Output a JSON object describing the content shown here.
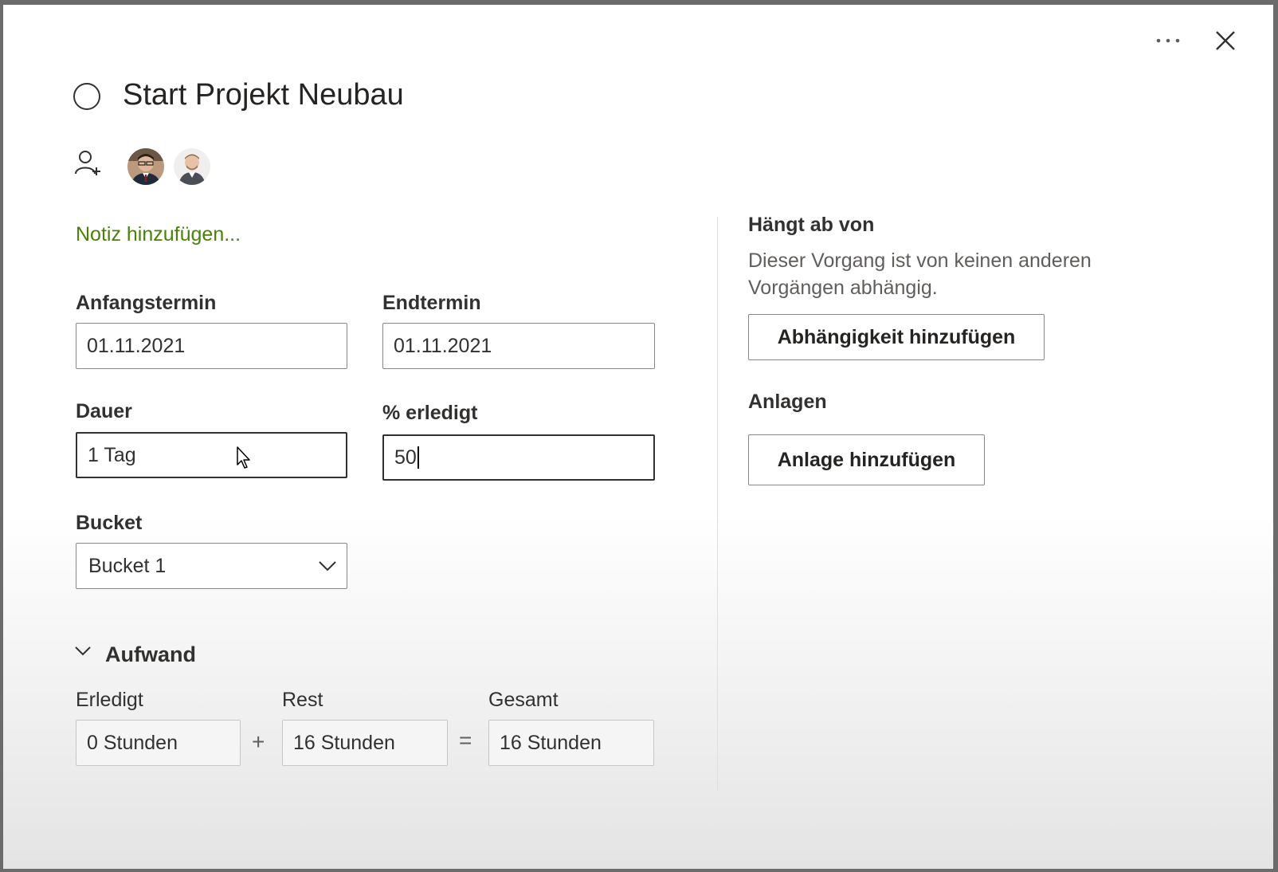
{
  "task": {
    "title": "Start Projekt Neubau",
    "add_note": "Notiz hinzufügen..."
  },
  "header": {
    "more_icon": "more-horizontal-icon",
    "close_icon": "close-icon"
  },
  "assignees": {
    "add_icon": "person-add-icon"
  },
  "fields": {
    "start_label": "Anfangstermin",
    "start_value": "01.11.2021",
    "end_label": "Endtermin",
    "end_value": "01.11.2021",
    "duration_label": "Dauer",
    "duration_value": "1 Tag",
    "percent_label": "% erledigt",
    "percent_value": "50",
    "bucket_label": "Bucket",
    "bucket_value": "Bucket 1"
  },
  "effort": {
    "section_label": "Aufwand",
    "done_label": "Erledigt",
    "done_value": "0 Stunden",
    "rest_label": "Rest",
    "rest_value": "16 Stunden",
    "total_label": "Gesamt",
    "total_value": "16 Stunden",
    "plus": "+",
    "equals": "="
  },
  "dependencies": {
    "title": "Hängt ab von",
    "description": "Dieser Vorgang ist von keinen anderen Vorgängen abhängig.",
    "add_button": "Abhängigkeit hinzufügen"
  },
  "attachments": {
    "title": "Anlagen",
    "add_button": "Anlage hinzufügen"
  }
}
